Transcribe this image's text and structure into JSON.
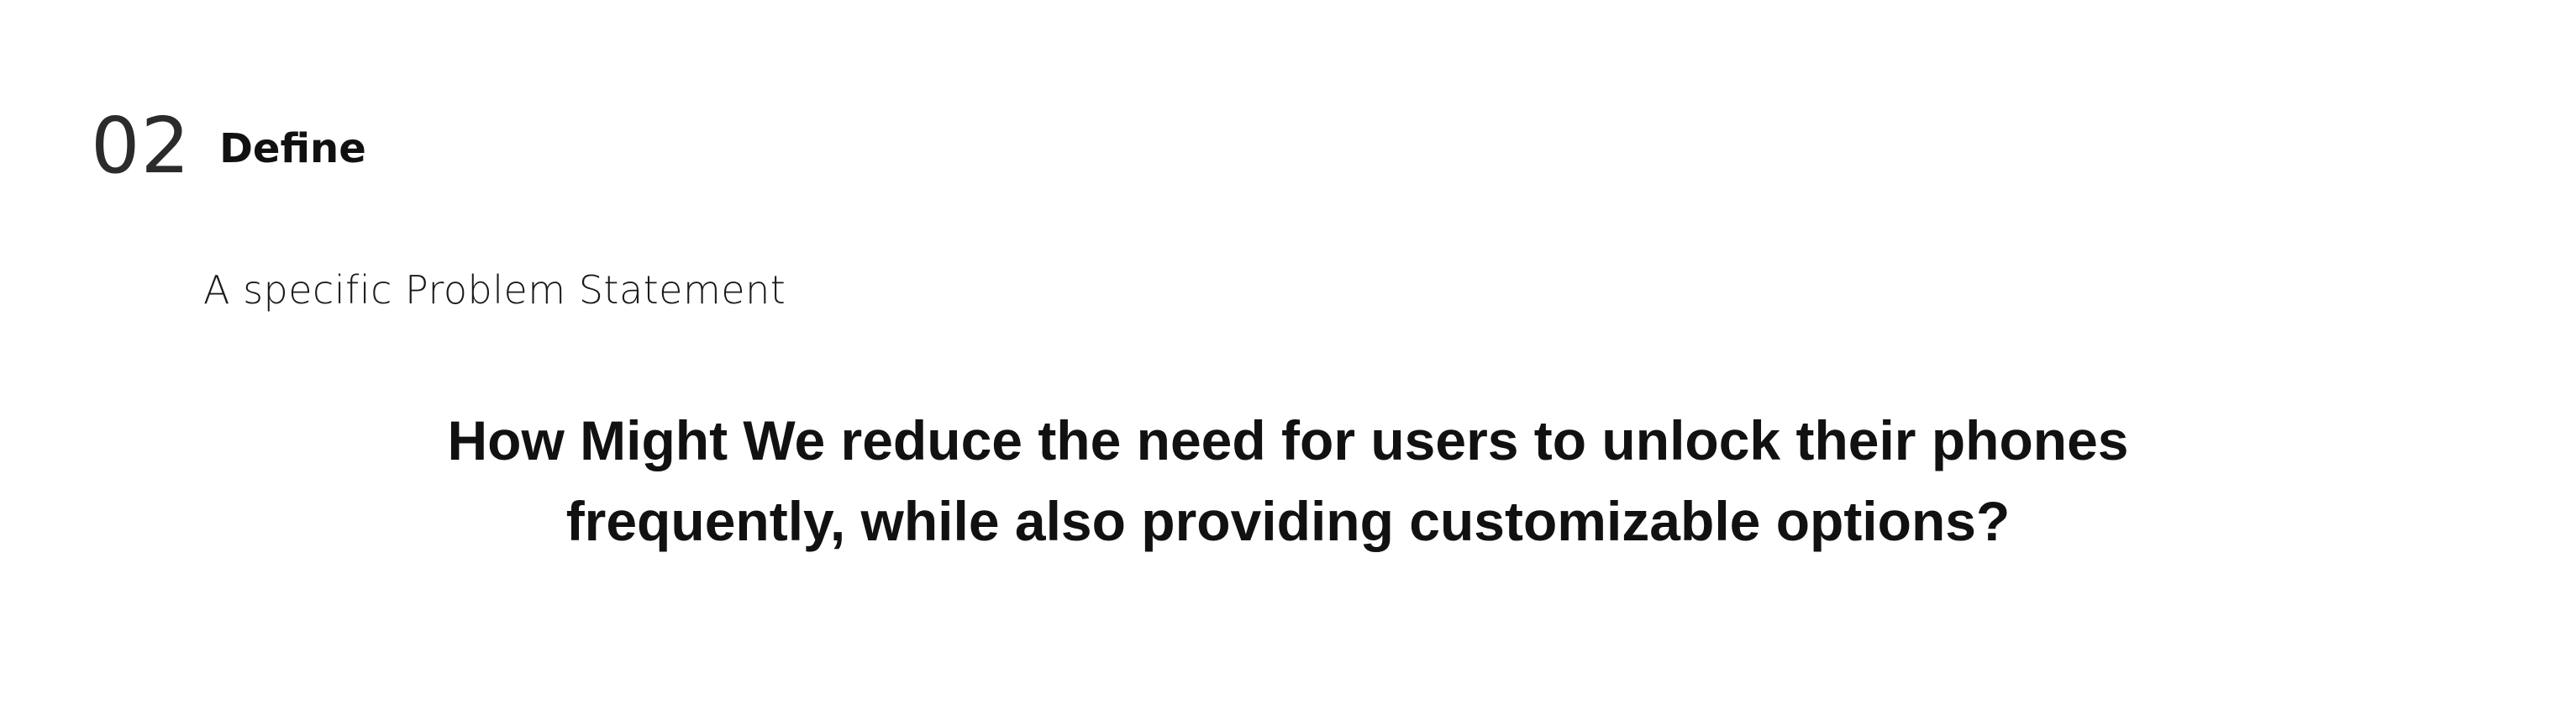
{
  "section": {
    "number": "02",
    "title": "Define"
  },
  "subtitle": "A specific Problem Statement",
  "statement": {
    "line1": "How Might We reduce the need for users to unlock their phones",
    "line2": "frequently, while also providing customizable options?"
  }
}
